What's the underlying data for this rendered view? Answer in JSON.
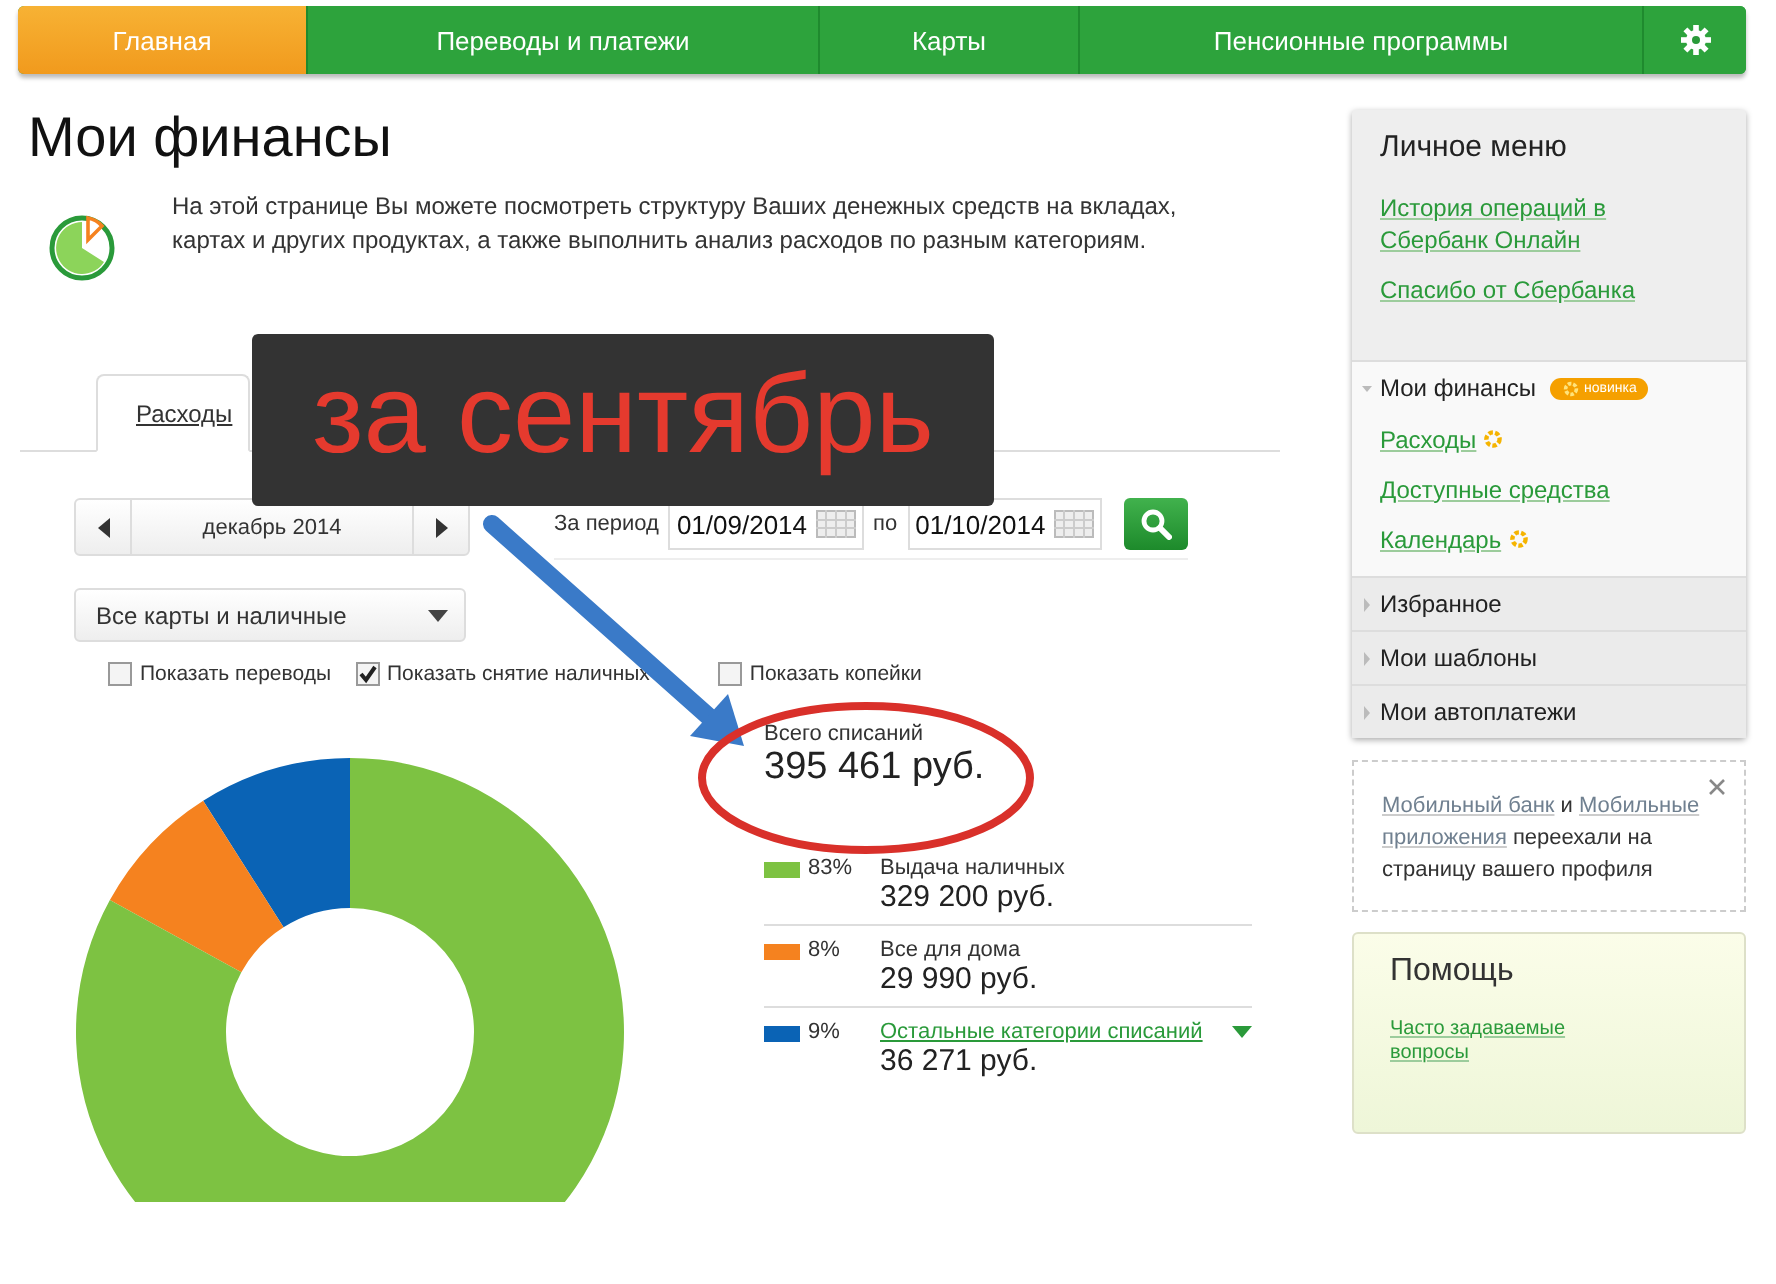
{
  "nav": [
    {
      "label": "Главная",
      "selected": true
    },
    {
      "label": "Переводы и платежи",
      "selected": false
    },
    {
      "label": "Карты",
      "selected": false
    },
    {
      "label": "Пенсионные программы",
      "selected": false
    }
  ],
  "page": {
    "title": "Мои финансы",
    "intro": "На этой странице Вы можете посмотреть структуру Ваших денежных средств на вкладах, картах и других продуктах, а также выполнить анализ расходов по разным категориям."
  },
  "tabs": [
    {
      "label": "Расходы",
      "selected": true
    }
  ],
  "period": {
    "month": "декабрь 2014",
    "from_label": "За период",
    "from": "01/09/2014",
    "to_label": "по",
    "to": "01/10/2014"
  },
  "account_select": {
    "value": "Все карты и наличные"
  },
  "options": [
    {
      "label": "Показать переводы",
      "checked": false
    },
    {
      "label": "Показать снятие наличных",
      "checked": true
    },
    {
      "label": "Показать копейки",
      "checked": false
    }
  ],
  "summary": {
    "label": "Всего списаний",
    "total": "395 461 руб."
  },
  "categories": [
    {
      "percent": "83%",
      "amount": "329 200 руб.",
      "color": "#7dc242",
      "kind": "plain"
    },
    {
      "percent": "8%",
      "amount": "29 990 руб.",
      "color": "#f5821f",
      "kind": "plain"
    },
    {
      "percent": "9%",
      "amount": "36 271 руб.",
      "color": "#0a63b5",
      "kind": "link"
    }
  ],
  "chart_data": {
    "type": "donut",
    "categories": [
      "Выдача наличных",
      "Все для дома",
      "Остальные категории списаний"
    ],
    "values": [
      83,
      8,
      9
    ]
  },
  "sidebar": {
    "title": "Личное меню",
    "links": [
      "История операций в Сбербанк Онлайн",
      "Спасибо от Сбербанка"
    ],
    "sections": [
      {
        "label": "Мои финансы",
        "expanded": true,
        "badge": "новинка",
        "children": [
          {
            "label": "Расходы",
            "new": true
          },
          {
            "label": "Доступные средства",
            "new": false
          },
          {
            "label": "Календарь",
            "new": true
          }
        ]
      },
      {
        "label": "Избранное",
        "expanded": false
      },
      {
        "label": "Мои шаблоны",
        "expanded": false
      },
      {
        "label": "Мои автоплатежи",
        "expanded": false
      }
    ]
  },
  "notice": {
    "parts": [
      {
        "text": "Мобильный банк",
        "kind": "link"
      },
      {
        "text": " и ",
        "kind": "plain"
      },
      {
        "text": "Мобильные приложения",
        "kind": "link"
      },
      {
        "text": " переехали на страницу вашего профиля",
        "kind": "plain"
      }
    ]
  },
  "help": {
    "title": "Помощь",
    "links": [
      "Часто задаваемые вопросы"
    ]
  },
  "annotation": {
    "caption": "за сентябрь"
  }
}
